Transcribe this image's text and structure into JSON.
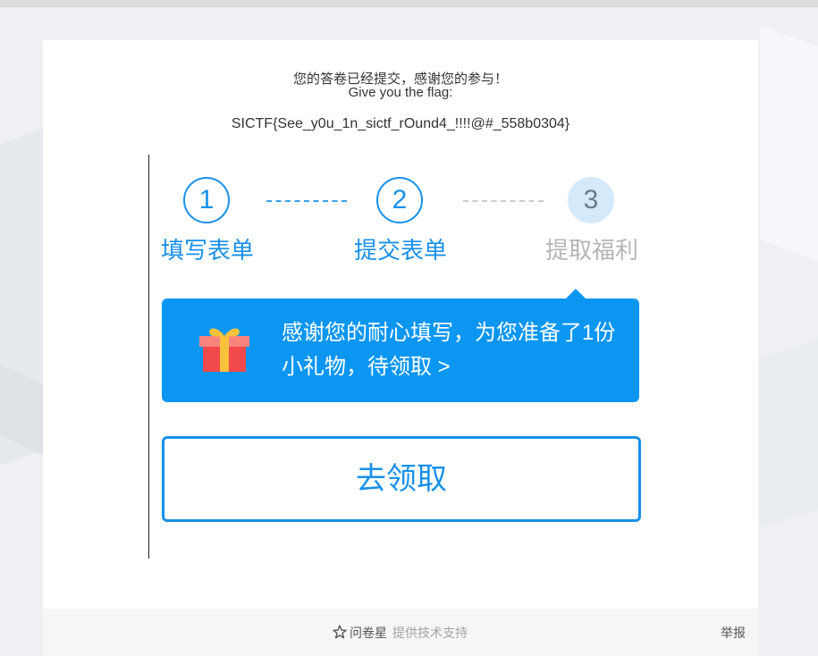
{
  "result": {
    "thanks": "您的答卷已经提交，感谢您的参与！",
    "flag_prompt": "Give you the flag:",
    "flag": "SICTF{See_y0u_1n_sictf_rOund4_!!!!@#_558b0304}"
  },
  "steps": [
    {
      "number": "1",
      "label": "填写表单",
      "active": true
    },
    {
      "number": "2",
      "label": "提交表单",
      "active": true
    },
    {
      "number": "3",
      "label": "提取福利",
      "active": false
    }
  ],
  "reward": {
    "text": "感谢您的耐心填写，为您准备了1份小礼物，待领取 >",
    "icon": "gift-icon"
  },
  "claim_button": {
    "label": "去领取"
  },
  "footer": {
    "brand": "问卷星",
    "brand_icon": "star-icon",
    "support": "提供技术支持",
    "report": "举报"
  },
  "colors": {
    "accent": "#1890e8",
    "banner": "#0b96f2",
    "inactive": "#b5b5b5"
  }
}
